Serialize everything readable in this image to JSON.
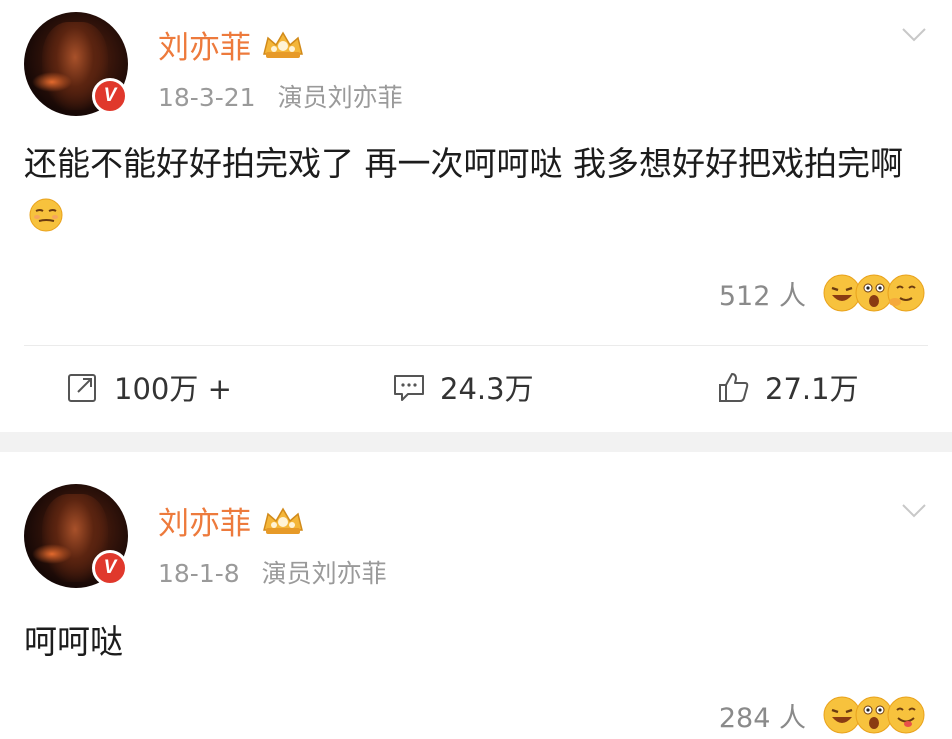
{
  "posts": [
    {
      "username": "刘亦菲",
      "date": "18-3-21",
      "source": "演员刘亦菲",
      "content": "还能不能好好拍完戏了 再一次呵呵哒 我多想好好把戏拍完啊",
      "reaction_count": "512 人",
      "actions": {
        "repost": "100万 +",
        "comment": "24.3万",
        "like": "27.1万"
      }
    },
    {
      "username": "刘亦菲",
      "date": "18-1-8",
      "source": "演员刘亦菲",
      "content": "呵呵哒",
      "reaction_count": "284 人"
    }
  ],
  "icons": {
    "verified_badge": "V",
    "vip": "vip-crown-icon",
    "more": "chevron-down-icon",
    "repost": "repost-icon",
    "comment": "comment-icon",
    "like": "thumbs-up-icon"
  },
  "colors": {
    "username": "#ed7a3c",
    "meta": "#9a9a9a",
    "verified": "#e0382c",
    "separator": "#f2f2f2"
  }
}
